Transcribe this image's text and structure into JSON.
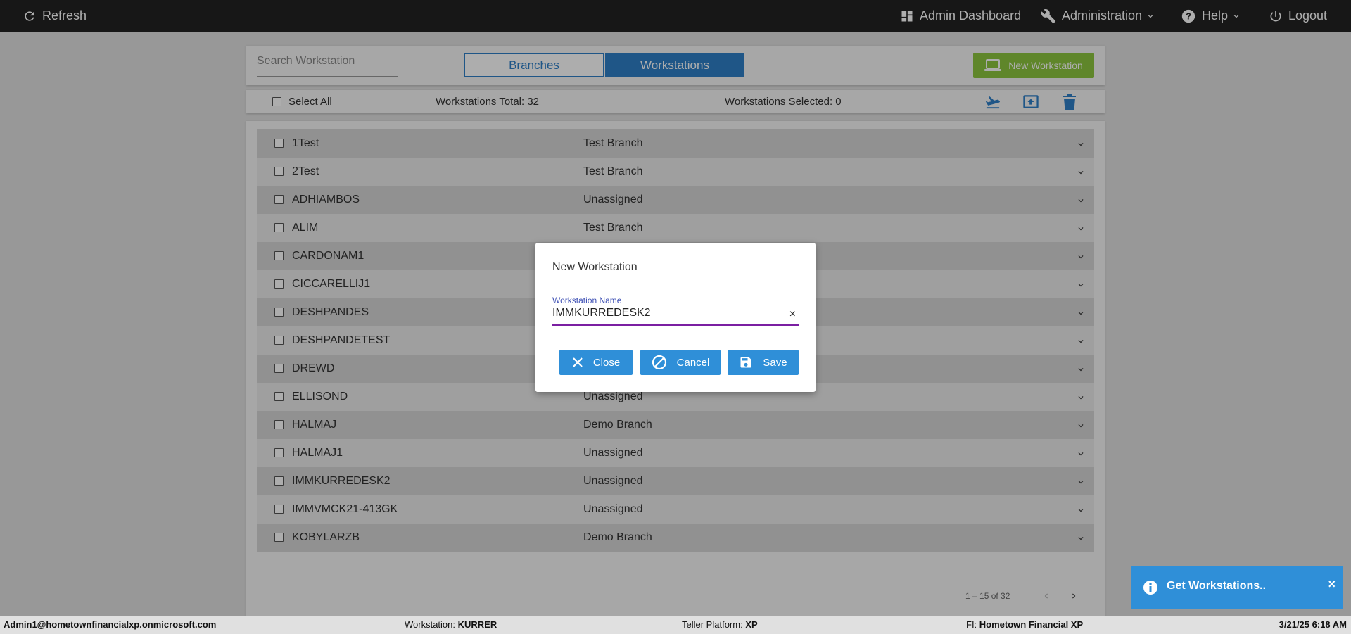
{
  "topbar": {
    "refresh": "Refresh",
    "admin_dashboard": "Admin Dashboard",
    "administration": "Administration",
    "help": "Help",
    "logout": "Logout"
  },
  "search": {
    "placeholder": "Search Workstation"
  },
  "tabs": {
    "branches": "Branches",
    "workstations": "Workstations",
    "active": "Workstations"
  },
  "new_workstation_button": "New Workstation",
  "list_toolbar": {
    "select_all": "Select All",
    "total": "Workstations Total: 32",
    "selected": "Workstations Selected: 0"
  },
  "rows": [
    {
      "name": "1Test",
      "branch": "Test Branch"
    },
    {
      "name": "2Test",
      "branch": "Test Branch"
    },
    {
      "name": "ADHIAMBOS",
      "branch": "Unassigned"
    },
    {
      "name": "ALIM",
      "branch": "Test Branch"
    },
    {
      "name": "CARDONAM1",
      "branch": ""
    },
    {
      "name": "CICCARELLIJ1",
      "branch": ""
    },
    {
      "name": "DESHPANDES",
      "branch": ""
    },
    {
      "name": "DESHPANDETEST",
      "branch": ""
    },
    {
      "name": "DREWD",
      "branch": ""
    },
    {
      "name": "ELLISOND",
      "branch": "Unassigned"
    },
    {
      "name": "HALMAJ",
      "branch": "Demo Branch"
    },
    {
      "name": "HALMAJ1",
      "branch": "Unassigned"
    },
    {
      "name": "IMMKURREDESK2",
      "branch": "Unassigned"
    },
    {
      "name": "IMMVMCK21-413GK",
      "branch": "Unassigned"
    },
    {
      "name": "KOBYLARZB",
      "branch": "Demo Branch"
    }
  ],
  "pager": {
    "range": "1 – 15 of 32"
  },
  "dialog": {
    "title": "New Workstation",
    "field_label": "Workstation Name",
    "field_value": "IMMKURREDESK2",
    "clear": "×",
    "close": "Close",
    "cancel": "Cancel",
    "save": "Save"
  },
  "toast": {
    "message": "Get Workstations..",
    "close": "×"
  },
  "status_bar": {
    "user": "Admin1@hometownfinancialxp.onmicrosoft.com",
    "workstation_label": "Workstation: ",
    "workstation_value": "KURRER",
    "platform_label": "Teller Platform: ",
    "platform_value": "XP",
    "fi_label": "FI: ",
    "fi_value": "Hometown Financial XP",
    "datetime": "3/21/25 6:18 AM"
  },
  "colors": {
    "topbar": "#222222",
    "primary": "#2f8fd8",
    "accent_green": "#8dc63f",
    "field_underline": "#7b1fa2"
  }
}
